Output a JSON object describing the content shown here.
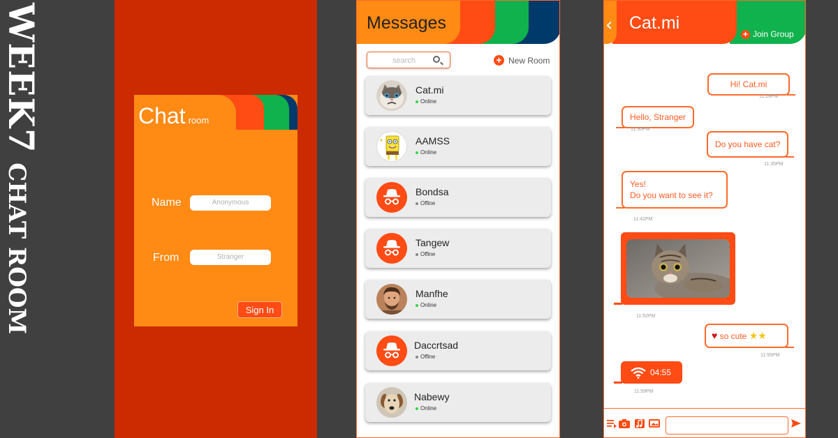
{
  "poster": {
    "title_big": "WEEK7",
    "title_small": "CHAT ROOM"
  },
  "login": {
    "title_main": "Chat",
    "title_sub": "room",
    "name_label": "Name",
    "name_placeholder": "Anonymous",
    "from_label": "From",
    "from_placeholder": "Stranger",
    "signin_label": "Sign In"
  },
  "messages": {
    "title": "Messages",
    "search_placeholder": "search",
    "new_room_label": "New Room",
    "rooms": [
      {
        "name": "Cat.mi",
        "status": "Online",
        "avatar": "cat-avatar"
      },
      {
        "name": "AAMSS",
        "status": "Online",
        "avatar": "sponge-avatar"
      },
      {
        "name": "Bondsa",
        "status": "Offine",
        "avatar": "incognito-icon"
      },
      {
        "name": "Tangew",
        "status": "Offine",
        "avatar": "incognito-icon"
      },
      {
        "name": "Manfhe",
        "status": "Online",
        "avatar": "man-avatar"
      },
      {
        "name": "Daccrtsad",
        "status": "Offine",
        "avatar": "incognito-icon"
      },
      {
        "name": "Nabewy",
        "status": "Online",
        "avatar": "dog-avatar"
      }
    ]
  },
  "chat": {
    "title": "Cat.mi",
    "join_label": "Join Group",
    "msgs": [
      {
        "text": "Hi!  Cat.mi",
        "time": "11:28PM"
      },
      {
        "text": "Hello, Stranger",
        "time": "11:30PM"
      },
      {
        "text": "Do you have cat?",
        "time": "11:35PM"
      },
      {
        "line1": "Yes!",
        "line2": "Do you want to see it?",
        "time": "11:42PM"
      },
      {
        "time": "11:52PM"
      },
      {
        "text": "so cute",
        "time": "11:55PM"
      },
      {
        "text": "04:55",
        "time": "11:59PM"
      }
    ]
  },
  "colors": {
    "orange": "#ff8a14",
    "red_orange": "#ff4b14",
    "green": "#0fb24c",
    "navy": "#003a6b",
    "bg_red": "#cc2a00"
  }
}
